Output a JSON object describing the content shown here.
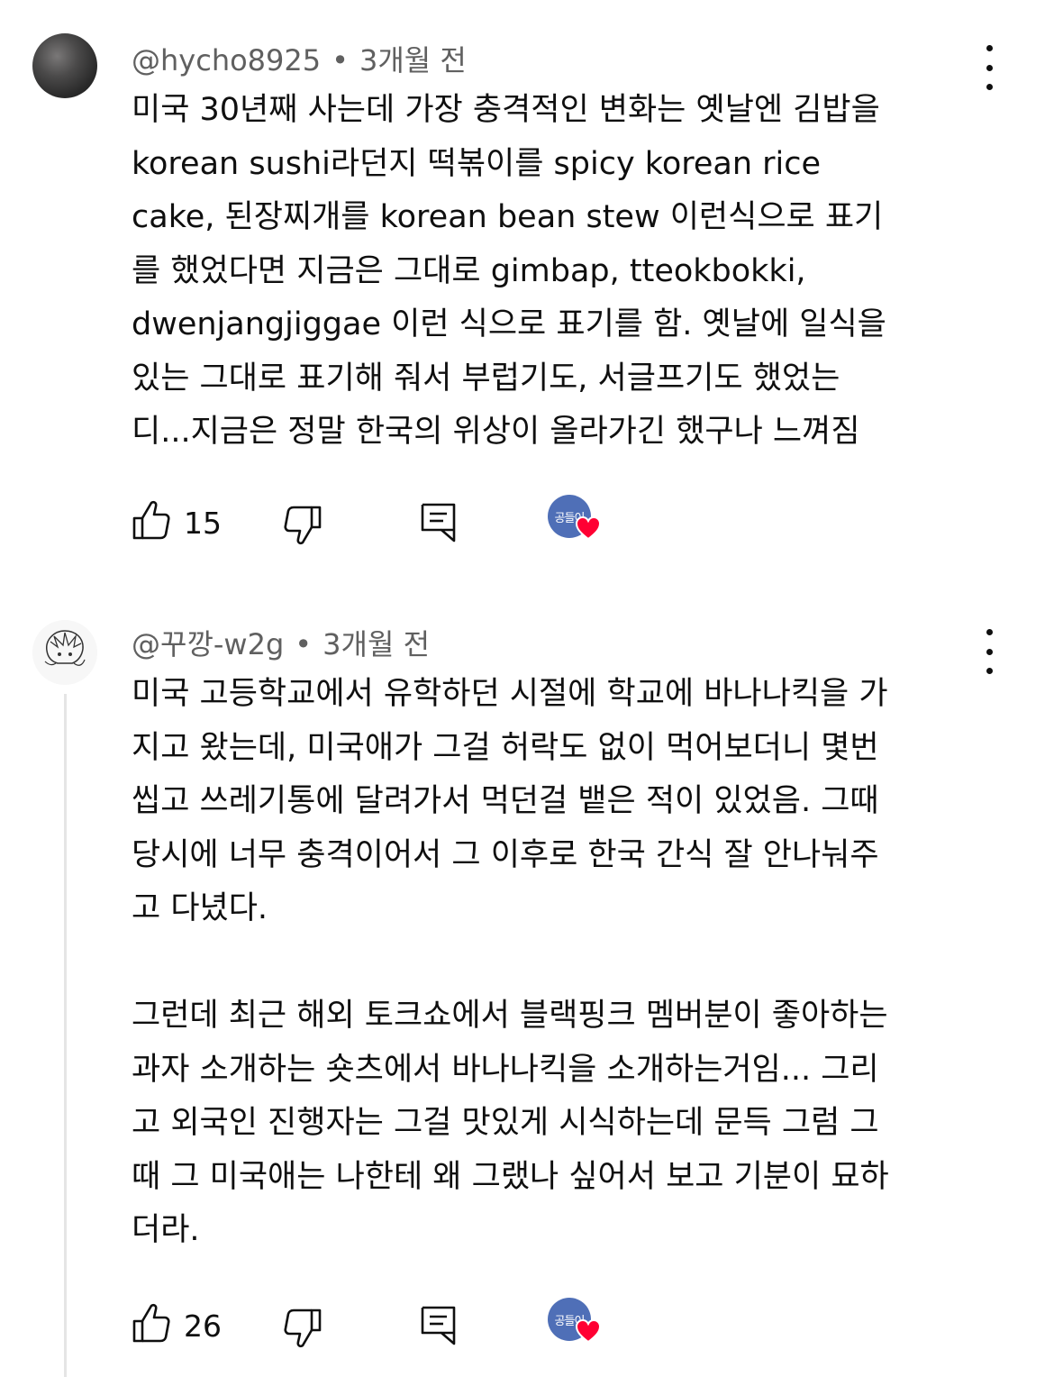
{
  "comments": [
    {
      "author": "@hycho8925",
      "separator": "•",
      "time": "3개월 전",
      "text": "미국 30년째 사는데 가장 충격적인 변화는 옛날엔 김밥을\nkorean sushi라던지 떡볶이를 spicy korean rice\ncake, 된장찌개를 korean bean stew 이런식으로 표기\n를 했었다면 지금은 그대로 gimbap, tteokbokki,\ndwenjangjiggae 이런 식으로 표기를 함.  옛날에 일식을\n있는 그대로 표기해 줘서 부럽기도, 서글프기도 했었는\n디...지금은 정말 한국의 위상이 올라가긴 했구나 느껴짐",
      "like_count": "15",
      "creator_label": "공들이"
    },
    {
      "author": "@꾸깡-w2g",
      "separator": "•",
      "time": "3개월 전",
      "text": "미국 고등학교에서 유학하던 시절에 학교에 바나나킥을 가\n지고 왔는데, 미국애가 그걸 허락도 없이 먹어보더니 몇번\n씹고 쓰레기통에 달려가서 먹던걸 뱉은 적이 있었음. 그때\n당시에 너무 충격이어서 그 이후로 한국 간식 잘 안나눠주\n고 다녔다.\n\n그런데 최근 해외 토크쇼에서 블랙핑크 멤버분이 좋아하는\n과자 소개하는 숏츠에서 바나나킥을 소개하는거임... 그리\n고 외국인 진행자는 그걸 맛있게 시식하는데 문득 그럼 그\n때 그 미국애는 나한테 왜 그랬나 싶어서 보고 기분이 묘하\n더라.",
      "like_count": "26",
      "creator_label": "공들이"
    }
  ],
  "colors": {
    "text": "#0f0f0f",
    "meta": "#606060",
    "creator_avatar": "#4f6fb7",
    "heart": "#ff0033",
    "thread_line": "#e5e5e5"
  },
  "icons": [
    "more-vert-icon",
    "thumb-up-icon",
    "thumb-down-icon",
    "reply-icon",
    "creator-heart-icon"
  ]
}
